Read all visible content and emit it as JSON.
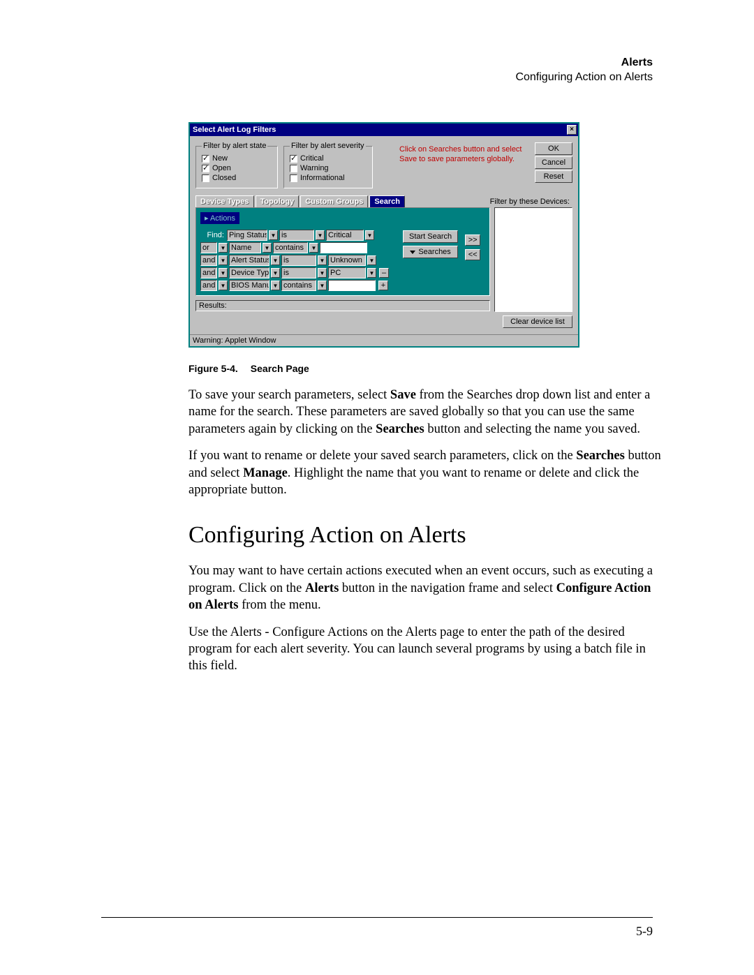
{
  "header": {
    "title_bold": "Alerts",
    "subtitle": "Configuring Action on Alerts"
  },
  "dialog": {
    "title": "Select Alert Log Filters",
    "close": "×",
    "state_legend": "Filter by alert state",
    "severity_legend": "Filter by alert severity",
    "states": [
      {
        "label": "New",
        "checked": true
      },
      {
        "label": "Open",
        "checked": true
      },
      {
        "label": "Closed",
        "checked": false
      }
    ],
    "severities": [
      {
        "label": "Critical",
        "checked": true
      },
      {
        "label": "Warning",
        "checked": false
      },
      {
        "label": "Informational",
        "checked": false
      }
    ],
    "hint": "Click on Searches button and select Save to save parameters globally.",
    "buttons": {
      "ok": "OK",
      "cancel": "Cancel",
      "reset": "Reset"
    },
    "tabs": {
      "device_types": "Device Types",
      "topology": "Topology",
      "custom_groups": "Custom Groups",
      "search": "Search"
    },
    "filter_by": "Filter by these Devices:",
    "actions_tab": "▸ Actions",
    "find_label": "Find:",
    "rows": [
      {
        "conj": "",
        "field": "Ping Status",
        "op": "is",
        "value": "Critical"
      },
      {
        "conj": "or",
        "field": "Name",
        "op": "contains",
        "value": ""
      },
      {
        "conj": "and",
        "field": "Alert Status",
        "op": "is",
        "value": "Unknown"
      },
      {
        "conj": "and",
        "field": "Device Typ",
        "op": "is",
        "value": "PC"
      },
      {
        "conj": "and",
        "field": "BIOS Manu",
        "op": "contains",
        "value": ""
      }
    ],
    "minus": "–",
    "plus": "+",
    "start_search": "Start Search",
    "searches": "Searches",
    "arrow_right": ">>",
    "arrow_left": "<<",
    "results": "Results:",
    "clear": "Clear device list",
    "status": "Warning: Applet Window"
  },
  "caption": {
    "prefix": "Figure 5-4.",
    "title": "Search Page"
  },
  "para1_a": "To save your search parameters, select ",
  "para1_b": "Save",
  "para1_c": " from the Searches drop down list and enter a name for the search. These parameters are saved globally so that you can use the same parameters again by clicking on the ",
  "para1_d": "Searches",
  "para1_e": " button and selecting the name you saved.",
  "para2_a": "If you want to rename or delete your saved search parameters, click on the ",
  "para2_b": "Searches",
  "para2_c": " button and select ",
  "para2_d": "Manage",
  "para2_e": ". Highlight the name that you want to rename or delete and click the appropriate button.",
  "h2": "Configuring Action on Alerts",
  "para3_a": "You may want to have certain actions executed when an event occurs, such as executing a program. Click on the ",
  "para3_b": "Alerts",
  "para3_c": " button in the navigation frame and select ",
  "para3_d": "Configure Action on Alerts",
  "para3_e": " from the menu.",
  "para4": "Use the Alerts - Configure Actions on the Alerts page to enter the path of the desired program for each alert severity. You can launch several programs by using a batch file in this field.",
  "page_number": "5-9"
}
